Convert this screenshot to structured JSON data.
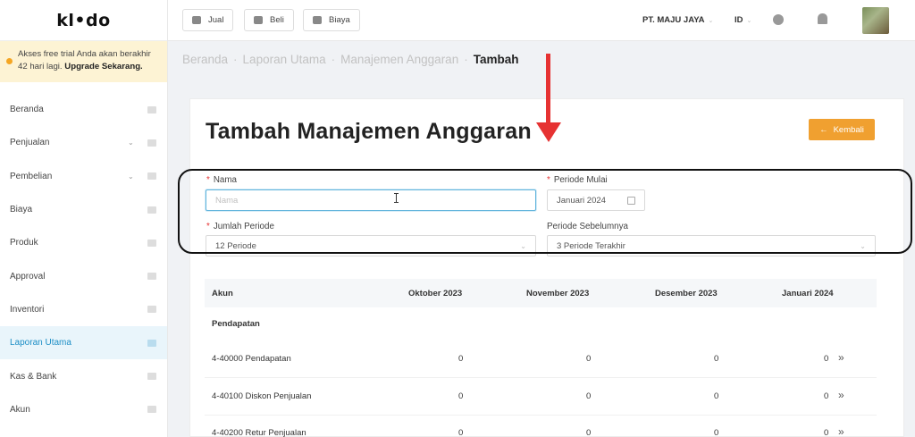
{
  "sidebar": {
    "logo": "kl•do",
    "trial_text": "Akses free trial Anda akan berakhir 42 hari lagi.",
    "trial_link": "Upgrade Sekarang.",
    "items": [
      {
        "label": "Beranda",
        "icon": "home-icon",
        "chevron": false
      },
      {
        "label": "Penjualan",
        "icon": "cart-icon",
        "chevron": true
      },
      {
        "label": "Pembelian",
        "icon": "bag-icon",
        "chevron": true
      },
      {
        "label": "Biaya",
        "icon": "wallet-icon",
        "chevron": false
      },
      {
        "label": "Produk",
        "icon": "box-icon",
        "chevron": false
      },
      {
        "label": "Approval",
        "icon": "check-icon",
        "chevron": false
      },
      {
        "label": "Inventori",
        "icon": "warehouse-icon",
        "chevron": false
      },
      {
        "label": "Laporan Utama",
        "icon": "chart-icon",
        "chevron": false,
        "active": true
      },
      {
        "label": "Kas & Bank",
        "icon": "coin-icon",
        "chevron": false
      },
      {
        "label": "Akun",
        "icon": "ledger-icon",
        "chevron": false
      }
    ]
  },
  "topbar": {
    "jual": "Jual",
    "beli": "Beli",
    "biaya": "Biaya",
    "company": "PT. MAJU JAYA",
    "lang": "ID"
  },
  "breadcrumb": {
    "items": [
      "Beranda",
      "Laporan Utama",
      "Manajemen Anggaran"
    ],
    "current": "Tambah"
  },
  "page": {
    "title": "Tambah Manajemen Anggaran",
    "back_label": "Kembali"
  },
  "form": {
    "nama_label": "Nama",
    "nama_placeholder": "Nama",
    "periode_mulai_label": "Periode Mulai",
    "periode_mulai_value": "Januari 2024",
    "jumlah_periode_label": "Jumlah Periode",
    "jumlah_periode_value": "12 Periode",
    "periode_sebelumnya_label": "Periode Sebelumnya",
    "periode_sebelumnya_value": "3 Periode Terakhir"
  },
  "table": {
    "headers": [
      "Akun",
      "Oktober 2023",
      "November 2023",
      "Desember 2023",
      "Januari 2024"
    ],
    "section": "Pendapatan",
    "rows": [
      {
        "akun": "4-40000 Pendapatan",
        "v": [
          "0",
          "0",
          "0",
          "0"
        ]
      },
      {
        "akun": "4-40100 Diskon Penjualan",
        "v": [
          "0",
          "0",
          "0",
          "0"
        ]
      },
      {
        "akun": "4-40200 Retur Penjualan",
        "v": [
          "0",
          "0",
          "0",
          "0"
        ]
      }
    ]
  },
  "colors": {
    "accent": "#1e8fc6",
    "button": "#f0a030",
    "arrow": "#e63232"
  }
}
